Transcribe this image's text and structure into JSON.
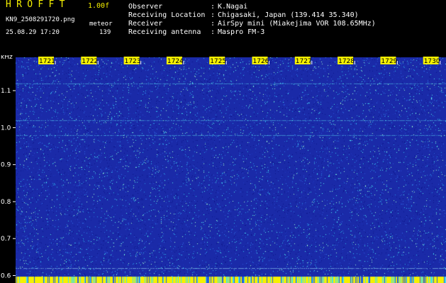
{
  "header": {
    "app_title": "HROFFT",
    "version": "1.00f",
    "filename": "KN9_2508291720.png",
    "mode": "meteor",
    "datetime": "25.08.29 17:20",
    "count": "139",
    "info": [
      {
        "label": "Observer",
        "value": "K.Nagai"
      },
      {
        "label": "Receiving Location",
        "value": "Chigasaki, Japan (139.414 35.340)"
      },
      {
        "label": "Receiver",
        "value": "AirSpy mini (Miakejima VOR 108.65MHz)"
      },
      {
        "label": "Receiving antenna",
        "value": "Maspro FM-3"
      }
    ],
    "separator": ":"
  },
  "waterfall": {
    "freq_unit": "kHz",
    "freq_min": 0.58,
    "freq_max": 1.19,
    "freq_ticks": [
      "1.1",
      "1.0",
      "0.9",
      "0.8",
      "0.7",
      "0.6"
    ],
    "freq_tick_values": [
      1.1,
      1.0,
      0.9,
      0.8,
      0.7,
      0.6
    ],
    "time_labels": [
      "1721",
      "1722",
      "1723",
      "1724",
      "1725",
      "1726",
      "1727",
      "1728",
      "1729",
      "1730"
    ],
    "colors": {
      "background": "#1a2aa8",
      "noise_low": "#0a1488",
      "noise_mid": "#2060e0",
      "noise_high": "#40e0f0",
      "signal_line": "#60f0ff",
      "timebar": "#f5f000",
      "label_bg": "#f5f000"
    },
    "carrier_lines_khz": [
      1.12,
      1.02,
      0.98,
      0.62
    ]
  }
}
